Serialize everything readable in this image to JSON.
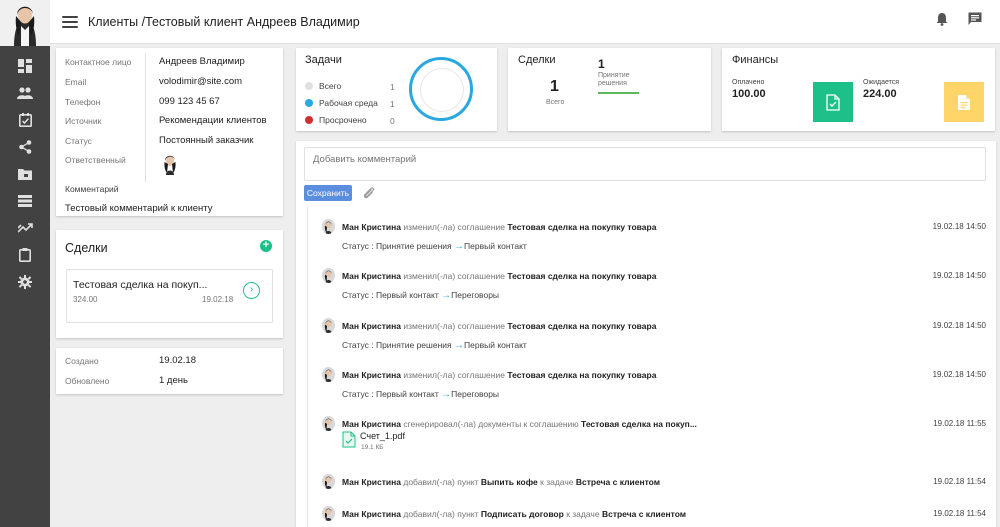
{
  "header": {
    "breadcrumb": "Клиенты /Тестовый клиент Андреев Владимир"
  },
  "nav_icons": [
    "dashboard-icon",
    "people-icon",
    "tasks-icon",
    "share-icon",
    "folder-icon",
    "list-icon",
    "trending-icon",
    "clipboard-icon",
    "settings-icon"
  ],
  "client_info": {
    "rows": [
      {
        "label": "Контактное лицо",
        "value": "Андреев Владимир"
      },
      {
        "label": "Email",
        "value": "volodimir@site.com"
      },
      {
        "label": "Телефон",
        "value": "099 123 45 67"
      },
      {
        "label": "Источник",
        "value": "Рекомендации клиентов"
      },
      {
        "label": "Статус",
        "value": "Постоянный заказчик"
      },
      {
        "label": "Ответственный",
        "value": ""
      }
    ],
    "comment_label": "Комментарий",
    "comment": "Тестовый комментарий к клиенту"
  },
  "deals_side": {
    "title": "Сделки",
    "deal": {
      "name": "Тестовая сделка на покуп...",
      "amount": "324.00",
      "date": "19.02.18"
    }
  },
  "meta": {
    "created_label": "Создано",
    "created": "19.02.18",
    "updated_label": "Обновлено",
    "updated": "1 день"
  },
  "tasks": {
    "title": "Задачи",
    "items": [
      {
        "label": "Всего",
        "count": "1",
        "color": "#e0e0e0"
      },
      {
        "label": "Рабочая среда",
        "count": "1",
        "color": "#29a8e0"
      },
      {
        "label": "Просрочено",
        "count": "0",
        "color": "#d32f2f"
      }
    ]
  },
  "deals_summary": {
    "title": "Сделки",
    "total": "1",
    "total_label": "Всего",
    "stage_count": "1",
    "stage_label": "Принятие решения"
  },
  "finance": {
    "title": "Финансы",
    "paid_label": "Оплачено",
    "paid": "100.00",
    "expected_label": "Ожидается",
    "expected": "224.00",
    "paid_color": "#1ec08a",
    "expected_color": "#ffd569"
  },
  "activity": {
    "comment_placeholder": "Добавить комментарий",
    "save_label": "Сохранить",
    "events": [
      {
        "user": "Ман Кристина",
        "action": "изменил(-ла) соглашение",
        "target": "Тестовая сделка на покупку товара",
        "date": "19.02.18 14:50",
        "status_label": "Статус :",
        "from": "Принятие решения",
        "to": "Первый контакт"
      },
      {
        "user": "Ман Кристина",
        "action": "изменил(-ла) соглашение",
        "target": "Тестовая сделка на покупку товара",
        "date": "19.02.18 14:50",
        "status_label": "Статус :",
        "from": "Первый контакт",
        "to": "Переговоры"
      },
      {
        "user": "Ман Кристина",
        "action": "изменил(-ла) соглашение",
        "target": "Тестовая сделка на покупку товара",
        "date": "19.02.18 14:50",
        "status_label": "Статус :",
        "from": "Принятие решения",
        "to": "Первый контакт"
      },
      {
        "user": "Ман Кристина",
        "action": "изменил(-ла) соглашение",
        "target": "Тестовая сделка на покупку товара",
        "date": "19.02.18 14:50",
        "status_label": "Статус :",
        "from": "Первый контакт",
        "to": "Переговоры"
      },
      {
        "user": "Ман Кристина",
        "action": "сгенерировал(-ла) документы к соглашению",
        "target": "Тестовая сделка на покуп...",
        "date": "19.02.18 11:55",
        "file_name": "Счет_1.pdf",
        "file_size": "19.1 КБ"
      },
      {
        "user": "Ман Кристина",
        "action": "добавил(-ла) пункт",
        "target": "Выпить кофе",
        "suffix": "к задаче",
        "suffix_target": "Встреча с клиентом",
        "date": "19.02.18 11:54"
      },
      {
        "user": "Ман Кристина",
        "action": "добавил(-ла) пункт",
        "target": "Подписать договор",
        "suffix": "к задаче",
        "suffix_target": "Встреча с клиентом",
        "date": "19.02.18 11:54"
      }
    ]
  }
}
